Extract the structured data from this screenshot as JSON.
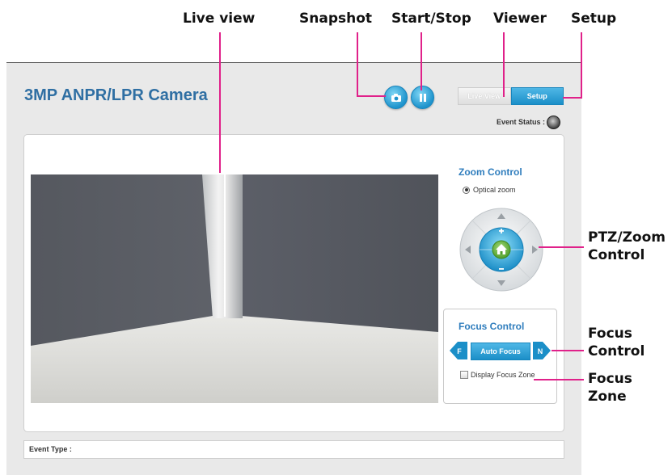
{
  "callouts": {
    "live_view": "Live view",
    "snapshot": "Snapshot",
    "start_stop": "Start/Stop",
    "viewer": "Viewer",
    "setup": "Setup",
    "ptz_line1": "PTZ/Zoom",
    "ptz_line2": "Control",
    "focus_line1": "Focus",
    "focus_line2": "Control",
    "zone_line1": "Focus",
    "zone_line2": "Zone"
  },
  "header": {
    "title": "3MP ANPR/LPR Camera",
    "tabs": {
      "live_view": "Live View",
      "setup": "Setup"
    },
    "event_status_label": "Event Status :"
  },
  "zoom": {
    "title": "Zoom Control",
    "mode_label": "Optical zoom",
    "mode_selected": true
  },
  "focus": {
    "title": "Focus Control",
    "far_label": "F",
    "near_label": "N",
    "auto_label": "Auto Focus",
    "display_zone_label": "Display Focus Zone",
    "display_zone_checked": false
  },
  "footer": {
    "event_type_label": "Event Type :"
  },
  "colors": {
    "accent": "#1b8fc8",
    "title_blue": "#2f6fa3",
    "callout_line": "#e0218a",
    "home_green": "#6fbe44"
  },
  "icons": {
    "snapshot": "camera-icon",
    "start_stop": "pause-icon",
    "home": "home-icon"
  }
}
